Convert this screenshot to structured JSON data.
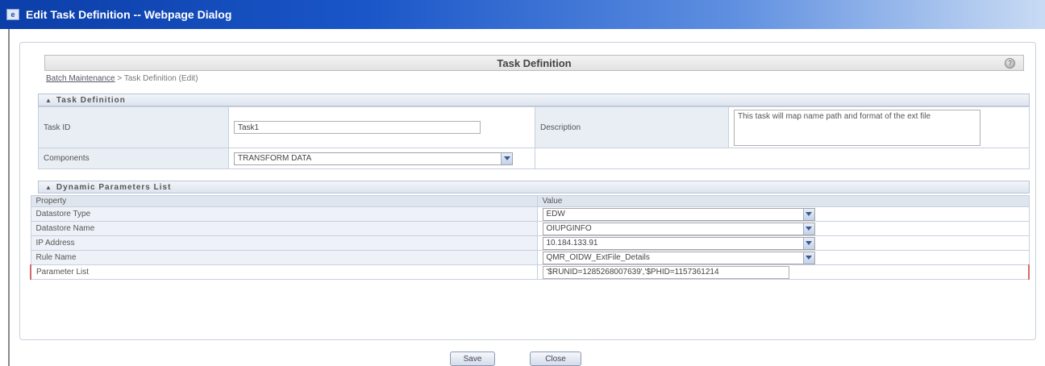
{
  "window": {
    "title": "Edit Task Definition -- Webpage Dialog"
  },
  "header": {
    "title": "Task Definition"
  },
  "breadcrumb": {
    "link": "Batch Maintenance",
    "rest": " > Task Definition (Edit)"
  },
  "task_section": {
    "title": "Task Definition",
    "task_id_label": "Task ID",
    "task_id_value": "Task1",
    "description_label": "Description",
    "description_value": "This task will map name path and format of the ext file",
    "components_label": "Components",
    "components_value": "TRANSFORM DATA"
  },
  "params_section": {
    "title": "Dynamic Parameters List",
    "col_property": "Property",
    "col_value": "Value",
    "rows": [
      {
        "property": "Datastore Type",
        "value": "EDW"
      },
      {
        "property": "Datastore Name",
        "value": "OIUPGINFO"
      },
      {
        "property": "IP Address",
        "value": "10.184.133.91"
      },
      {
        "property": "Rule Name",
        "value": "QMR_OIDW_ExtFile_Details"
      },
      {
        "property": "Parameter List",
        "value": "'$RUNID=1285268007639','$PHID=1157361214"
      }
    ]
  },
  "buttons": {
    "save": "Save",
    "close": "Close"
  },
  "colors": {
    "titlebar": "#0b3ea8",
    "highlight_border": "#d46a6a"
  }
}
